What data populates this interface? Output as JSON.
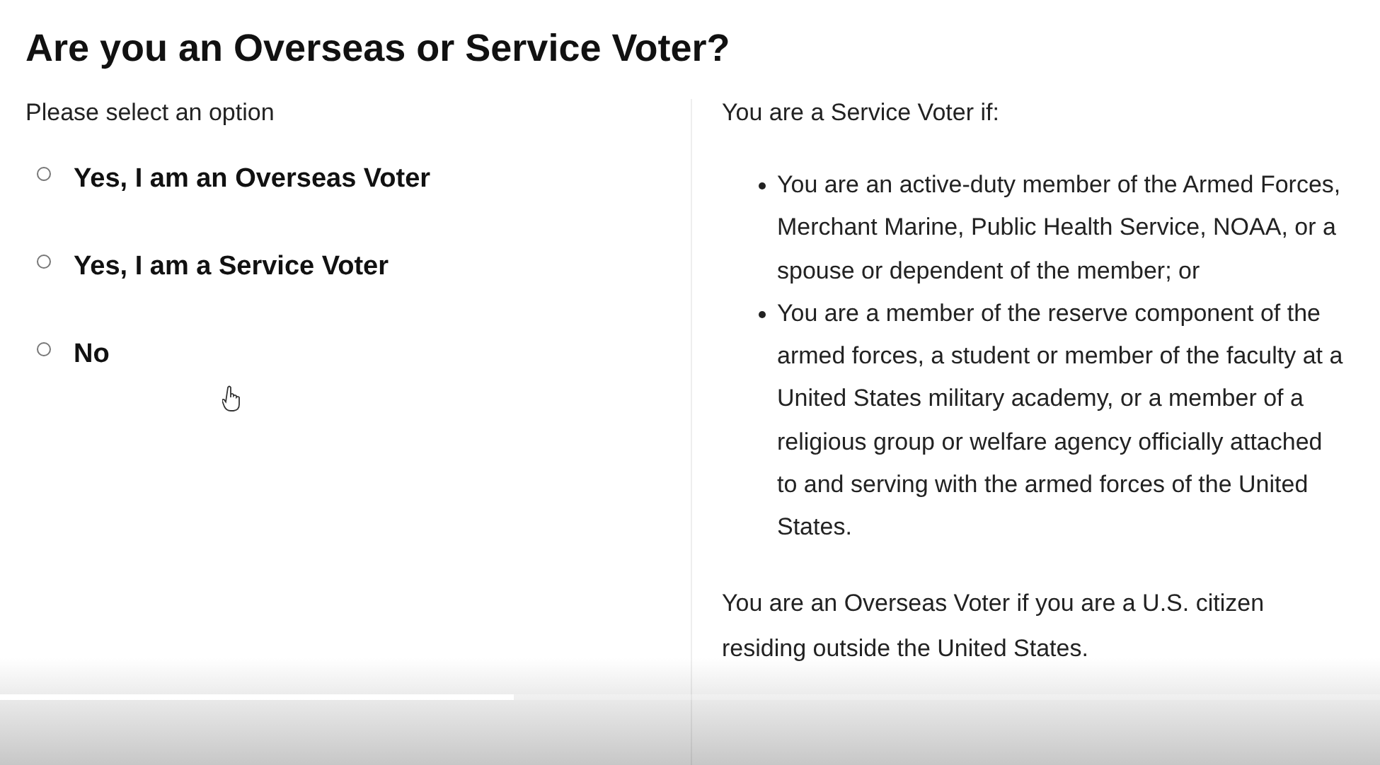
{
  "title": "Are you an Overseas or Service Voter?",
  "prompt": "Please select an option",
  "options": [
    {
      "label": "Yes, I am an Overseas Voter",
      "selected": false
    },
    {
      "label": "Yes, I am a Service Voter",
      "selected": false
    },
    {
      "label": "No",
      "selected": false
    }
  ],
  "service_heading": "You are a Service Voter if:",
  "service_criteria": [
    "You are an active-duty member of the Armed Forces, Merchant Marine, Public Health Service, NOAA, or a spouse or dependent of the member; or",
    "You are a member of the reserve component of the armed forces, a student or member of the faculty at a United States military academy, or a member of a religious group or welfare agency officially attached to and serving with the armed forces of the United States."
  ],
  "overseas_note": "You are an Overseas Voter if you are a U.S. citizen residing outside the United States.",
  "video_progress": {
    "level": 0.372
  }
}
